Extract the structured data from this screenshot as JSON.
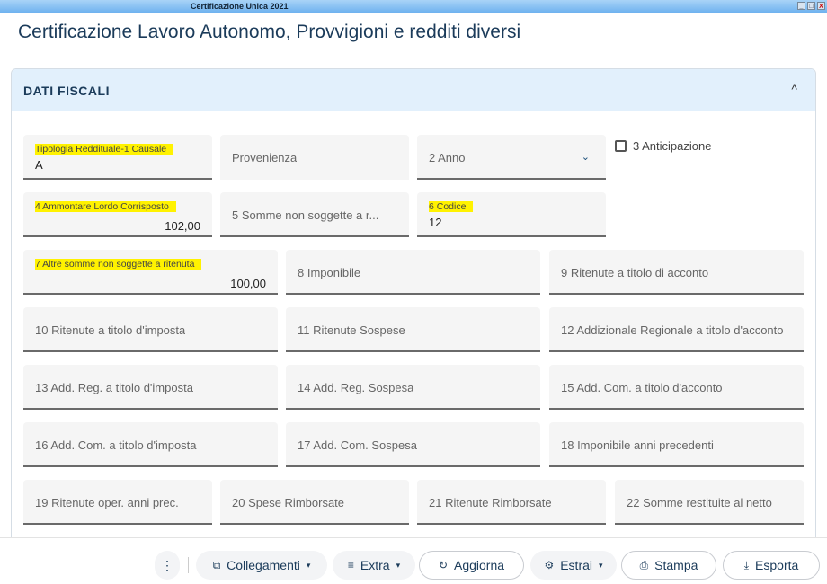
{
  "window": {
    "title": "Certificazione Unica 2021",
    "controls": [
      "_",
      "□",
      "X"
    ]
  },
  "page_title": "Certificazione Lavoro Autonomo, Provvigioni e redditi diversi",
  "section": {
    "title": "DATI FISCALI",
    "collapse_icon": "^"
  },
  "fields": {
    "causale": {
      "label": "Tipologia Reddituale-1 Causale",
      "value": "A"
    },
    "provenienza": {
      "label": "Provenienza"
    },
    "anno": {
      "label": "2 Anno",
      "icon": "⌄"
    },
    "anticipazione": {
      "label": "3 Anticipazione"
    },
    "f4": {
      "label": "4 Ammontare Lordo Corrisposto",
      "value": "102,00"
    },
    "f5": {
      "label": "5 Somme non soggette a r..."
    },
    "f6": {
      "label": "6 Codice",
      "value": "12"
    },
    "f7": {
      "label": "7 Altre somme non soggette a ritenuta",
      "value": "100,00"
    },
    "f8": {
      "label": "8 Imponibile"
    },
    "f9": {
      "label": "9 Ritenute a titolo di acconto"
    },
    "f10": {
      "label": "10 Ritenute a titolo d'imposta"
    },
    "f11": {
      "label": "11 Ritenute Sospese"
    },
    "f12": {
      "label": "12 Addizionale Regionale a titolo d'acconto"
    },
    "f13": {
      "label": "13 Add. Reg. a titolo d'imposta"
    },
    "f14": {
      "label": "14 Add. Reg. Sospesa"
    },
    "f15": {
      "label": "15 Add. Com. a titolo d'acconto"
    },
    "f16": {
      "label": "16 Add. Com. a titolo d'imposta"
    },
    "f17": {
      "label": "17 Add. Com. Sospesa"
    },
    "f18": {
      "label": "18 Imponibile anni precedenti"
    },
    "f19": {
      "label": "19 Ritenute oper. anni prec."
    },
    "f20": {
      "label": "20 Spese Rimborsate"
    },
    "f21": {
      "label": "21 Ritenute Rimborsate"
    },
    "f22": {
      "label": "22 Somme restituite al netto"
    }
  },
  "toolbar": {
    "more": "⋮",
    "collegamenti": "Collegamenti",
    "extra": "Extra",
    "aggiorna": "Aggiorna",
    "estrai": "Estrai",
    "stampa": "Stampa",
    "esporta": "Esporta"
  }
}
